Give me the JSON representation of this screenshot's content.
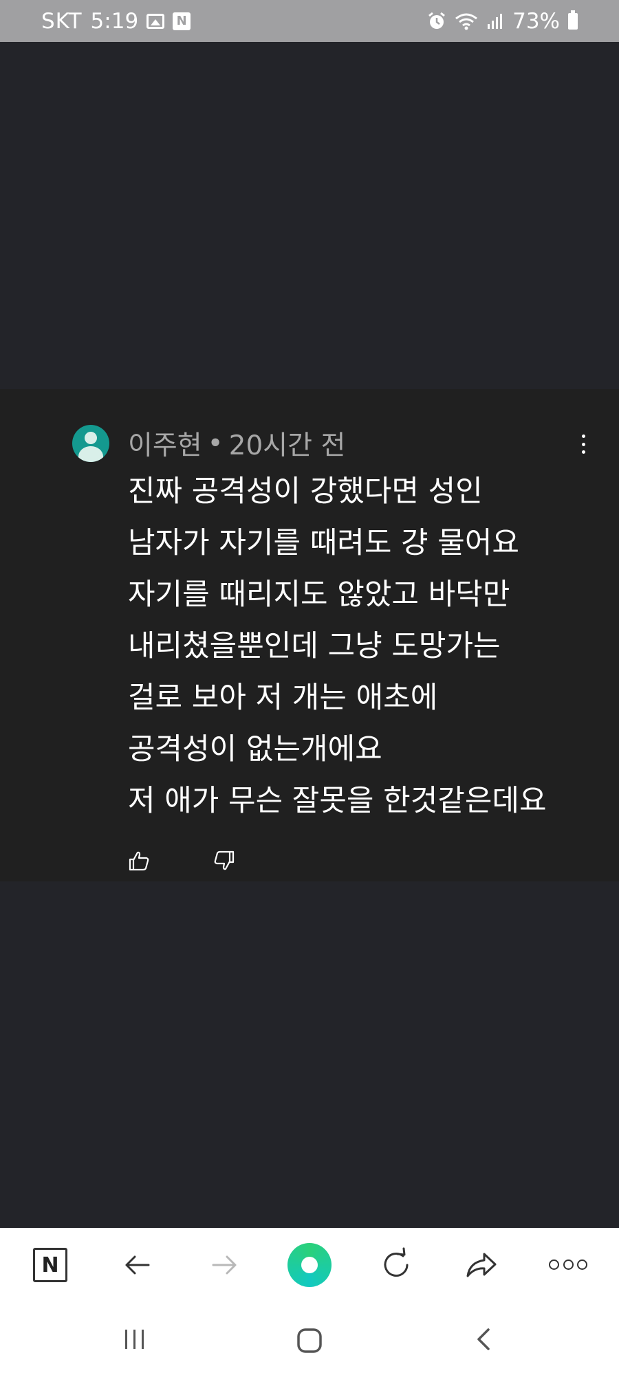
{
  "status_bar": {
    "carrier": "SKT",
    "time": "5:19",
    "battery": "73%",
    "notif_icons": [
      "gallery-icon",
      "naver-icon"
    ],
    "system_icons": [
      "alarm-icon",
      "wifi-icon",
      "signal-icon",
      "battery-icon"
    ]
  },
  "comment": {
    "author": "이주현",
    "separator": "•",
    "time_ago": "20시간 전",
    "lines": [
      "진짜 공격성이 강했다면 성인",
      "남자가 자기를 때려도 걍 물어요",
      "자기를 때리지도 않았고 바닥만",
      "내리쳤을뿐인데 그냥 도망가는",
      "걸로 보아 저 개는 애초에",
      "공격성이 없는개에요",
      "저 애가 무슨 잘못을 한것같은데요"
    ]
  },
  "toolbar": {
    "home_label": "N",
    "items": [
      "naver-home-button",
      "back-button",
      "forward-button",
      "green-dot-button",
      "refresh-button",
      "share-button",
      "more-menu-button"
    ]
  },
  "colors": {
    "page_bg": "#232429",
    "card_bg": "#202020",
    "avatar": "#14998f",
    "status_bar": "#a0a0a2"
  }
}
